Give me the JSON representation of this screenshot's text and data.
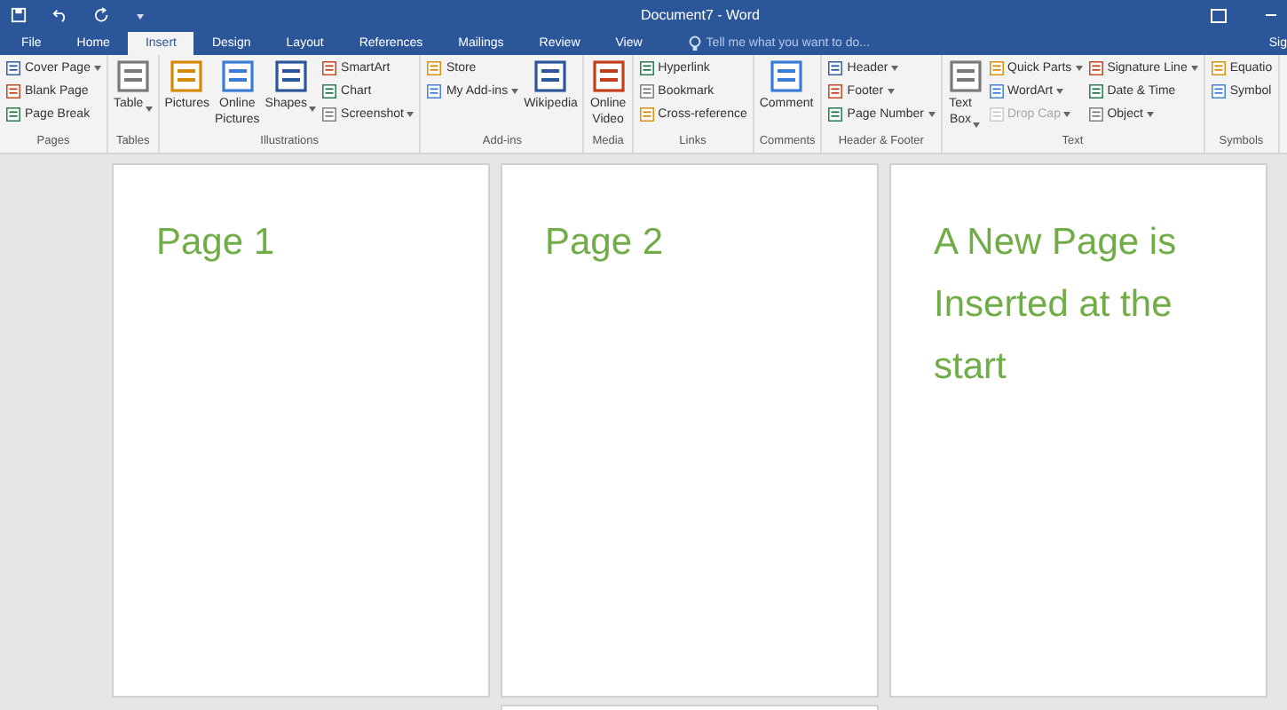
{
  "window": {
    "title": "Document7 - Word"
  },
  "tabs": [
    {
      "label": "File",
      "selected": false
    },
    {
      "label": "Home",
      "selected": false
    },
    {
      "label": "Insert",
      "selected": true
    },
    {
      "label": "Design",
      "selected": false
    },
    {
      "label": "Layout",
      "selected": false
    },
    {
      "label": "References",
      "selected": false
    },
    {
      "label": "Mailings",
      "selected": false
    },
    {
      "label": "Review",
      "selected": false
    },
    {
      "label": "View",
      "selected": false
    }
  ],
  "tell_me": {
    "placeholder": "Tell me what you want to do..."
  },
  "sign_in": "Sig",
  "ribbon_groups": [
    {
      "label": "Pages",
      "items": [
        {
          "label": "Cover Page",
          "kind": "small",
          "menu": true,
          "disabled": false
        },
        {
          "label": "Blank Page",
          "kind": "small",
          "menu": false,
          "disabled": false
        },
        {
          "label": "Page Break",
          "kind": "small",
          "menu": false,
          "disabled": false
        }
      ]
    },
    {
      "label": "Tables",
      "items": [
        {
          "label": "Table",
          "kind": "large",
          "menu": true,
          "disabled": false
        }
      ]
    },
    {
      "label": "Illustrations",
      "items": [
        {
          "label": "Pictures",
          "kind": "large",
          "menu": false,
          "disabled": false
        },
        {
          "label": "Online Pictures",
          "kind": "large",
          "menu": false,
          "disabled": false
        },
        {
          "label": "Shapes",
          "kind": "large",
          "menu": true,
          "disabled": false
        },
        {
          "label": "SmartArt",
          "kind": "small",
          "menu": false,
          "disabled": false
        },
        {
          "label": "Chart",
          "kind": "small",
          "menu": false,
          "disabled": false
        },
        {
          "label": "Screenshot",
          "kind": "small",
          "menu": true,
          "disabled": false
        }
      ]
    },
    {
      "label": "Add-ins",
      "items": [
        {
          "label": "Store",
          "kind": "small",
          "menu": false,
          "disabled": false
        },
        {
          "label": "My Add-ins",
          "kind": "small",
          "menu": true,
          "disabled": false
        },
        {
          "label": "Wikipedia",
          "kind": "large",
          "menu": false,
          "disabled": false
        }
      ]
    },
    {
      "label": "Media",
      "items": [
        {
          "label": "Online Video",
          "kind": "large",
          "menu": false,
          "disabled": false
        }
      ]
    },
    {
      "label": "Links",
      "items": [
        {
          "label": "Hyperlink",
          "kind": "small",
          "menu": false,
          "disabled": false
        },
        {
          "label": "Bookmark",
          "kind": "small",
          "menu": false,
          "disabled": false
        },
        {
          "label": "Cross-reference",
          "kind": "small",
          "menu": false,
          "disabled": false
        }
      ]
    },
    {
      "label": "Comments",
      "items": [
        {
          "label": "Comment",
          "kind": "large",
          "menu": false,
          "disabled": false
        }
      ]
    },
    {
      "label": "Header & Footer",
      "items": [
        {
          "label": "Header",
          "kind": "small",
          "menu": true,
          "disabled": false
        },
        {
          "label": "Footer",
          "kind": "small",
          "menu": true,
          "disabled": false
        },
        {
          "label": "Page Number",
          "kind": "small",
          "menu": true,
          "disabled": false
        }
      ]
    },
    {
      "label": "Text",
      "items": [
        {
          "label": "Text Box",
          "kind": "large",
          "menu": true,
          "disabled": false
        },
        {
          "label": "Quick Parts",
          "kind": "small",
          "menu": true,
          "disabled": false
        },
        {
          "label": "WordArt",
          "kind": "small",
          "menu": true,
          "disabled": false
        },
        {
          "label": "Drop Cap",
          "kind": "small",
          "menu": true,
          "disabled": true
        },
        {
          "label": "Signature Line",
          "kind": "small",
          "menu": true,
          "disabled": false
        },
        {
          "label": "Date & Time",
          "kind": "small",
          "menu": false,
          "disabled": false
        },
        {
          "label": "Object",
          "kind": "small",
          "menu": true,
          "disabled": false
        }
      ]
    },
    {
      "label": "Symbols",
      "items": [
        {
          "label": "Equatio",
          "kind": "small",
          "menu": false,
          "disabled": false
        },
        {
          "label": "Symbol",
          "kind": "small",
          "menu": false,
          "disabled": false
        }
      ]
    }
  ],
  "pages": [
    {
      "text": "Page 1",
      "partial": false
    },
    {
      "text": "Page 2",
      "partial": false
    },
    {
      "text": "A New Page is Inserted at the start",
      "partial": false
    },
    {
      "partial": true
    }
  ]
}
